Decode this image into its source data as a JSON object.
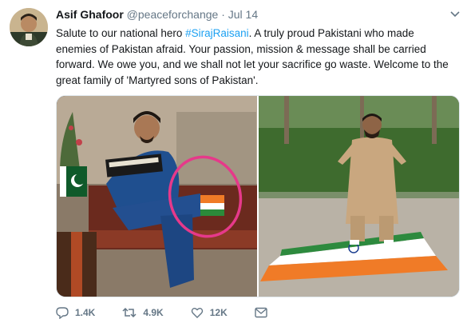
{
  "author": {
    "name": "Asif Ghafoor",
    "handle": "@peaceforchange",
    "separator": "·",
    "date": "Jul 14"
  },
  "tweet": {
    "text_before": "Salute to our national hero ",
    "hashtag": "#SirajRaisani",
    "text_after": ". A truly proud Pakistani who made enemies of Pakistan afraid. Your passion, mission & message shall be carried forward. We owe you, and we shall not let your sacrifice go waste. Welcome to the great family of 'Martyred sons of Pakistan'."
  },
  "actions": {
    "replies": "1.4K",
    "retweets": "4.9K",
    "likes": "12K"
  },
  "icons": [
    "chevron-down-icon",
    "reply-icon",
    "retweet-icon",
    "like-icon",
    "message-icon"
  ],
  "colors": {
    "hashtag": "#1da1f2",
    "meta": "#657786",
    "circle_annotation": "#e6398a"
  }
}
